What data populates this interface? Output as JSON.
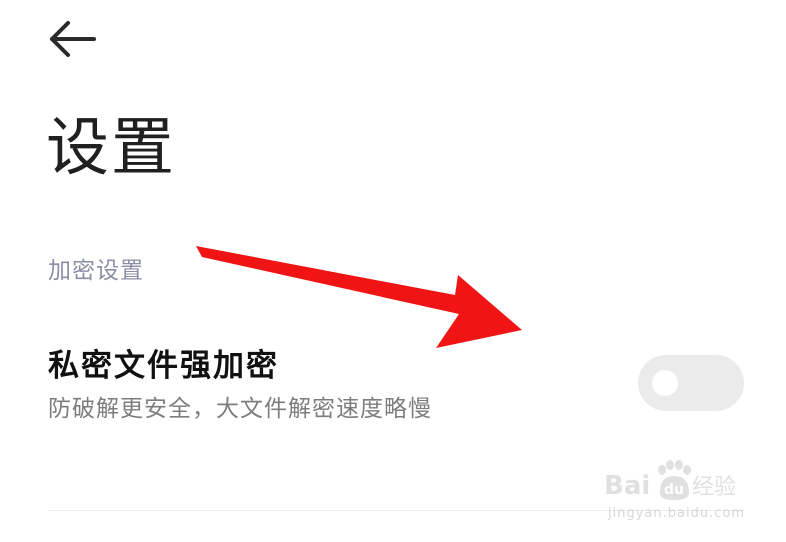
{
  "header": {
    "back_icon": "arrow-left-icon",
    "title": "设置"
  },
  "section": {
    "title": "加密设置"
  },
  "setting": {
    "title": "私密文件强加密",
    "description": "防破解更安全，大文件解密速度略慢",
    "toggle_on": false
  },
  "annotation": {
    "type": "arrow",
    "color": "#f01414"
  },
  "watermark": {
    "logo": "Bai du 经验",
    "url": "jingyan.baidu.com"
  },
  "colors": {
    "background": "#ffffff",
    "title_text": "#202020",
    "section_text": "#8a8ea6",
    "description_text": "#7d7d7d",
    "toggle_track_off": "#ebebeb",
    "toggle_knob": "#ffffff"
  }
}
